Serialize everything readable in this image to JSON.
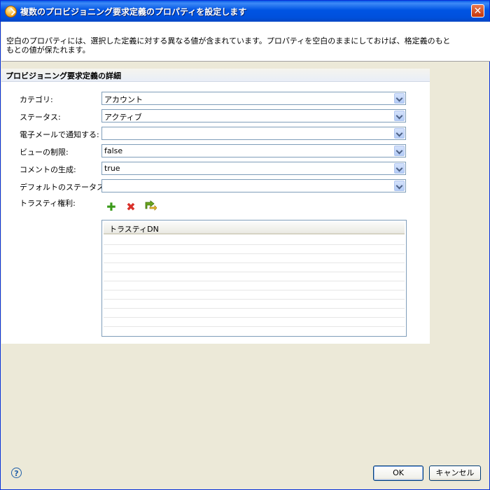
{
  "window": {
    "title": "複数のプロビジョニング要求定義のプロパティを設定します",
    "close_symbol": "✕"
  },
  "info": {
    "text": "空白のプロパティには、選択した定義に対する異なる値が含まれています。プロパティを空白のままにしておけば、格定義のもともとの値が保たれます。"
  },
  "section": {
    "title": "プロビジョニング要求定義の詳細",
    "fields": [
      {
        "label": "カテゴリ:",
        "value": "アカウント"
      },
      {
        "label": "ステータス:",
        "value": "アクティブ"
      },
      {
        "label": "電子メールで通知する:",
        "value": ""
      },
      {
        "label": "ビューの制限:",
        "value": "false"
      },
      {
        "label": "コメントの生成:",
        "value": "true"
      },
      {
        "label": "デフォルトのステータス:",
        "value": ""
      }
    ],
    "trustee": {
      "label": "トラスティ権利:",
      "icons": [
        "add-icon",
        "delete-icon",
        "edit-icon"
      ],
      "column_header": "トラスティDN",
      "rows": []
    }
  },
  "footer": {
    "help_symbol": "?",
    "ok_label": "OK",
    "cancel_label": "キャンセル"
  },
  "colors": {
    "titlebar": "#0054e3",
    "add_icon": "#3a9a1a",
    "delete_icon": "#d9302a",
    "edit_icon": "#6aa51d"
  }
}
